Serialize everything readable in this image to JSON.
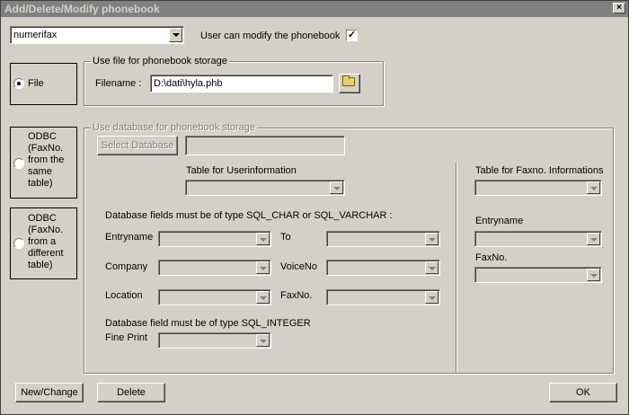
{
  "window": {
    "title": "Add/Delete/Modify phonebook"
  },
  "top": {
    "phonebook_select": "numerifax",
    "modify_label": "User can modify the phonebook",
    "modify_checked": "✓"
  },
  "storage": {
    "file_option": "File",
    "odbc_same_option": "ODBC (FaxNo. from the same table)",
    "odbc_diff_option": "ODBC (FaxNo. from a different table)"
  },
  "file_group": {
    "legend": "Use file for phonebook storage",
    "filename_label": "Filename :",
    "filename_value": "D:\\dati\\hyla.phb"
  },
  "db_group": {
    "legend": "Use database for phonebook storage",
    "select_db_button": "Select Database",
    "user_table_label": "Table for Userinformation",
    "char_notice": "Database fields must be of type SQL_CHAR or SQL_VARCHAR :",
    "entryname_label": "Entryname",
    "company_label": "Company",
    "location_label": "Location",
    "to_label": "To",
    "voiceno_label": "VoiceNo",
    "faxno_label": "FaxNo.",
    "int_notice": "Database field must be of type SQL_INTEGER",
    "fineprint_label": "Fine Print",
    "faxno_table_label": "Table for Faxno. Informations",
    "entryname2_label": "Entryname",
    "faxno2_label": "FaxNo."
  },
  "buttons": {
    "new_change": "New/Change",
    "delete": "Delete",
    "ok": "OK"
  }
}
